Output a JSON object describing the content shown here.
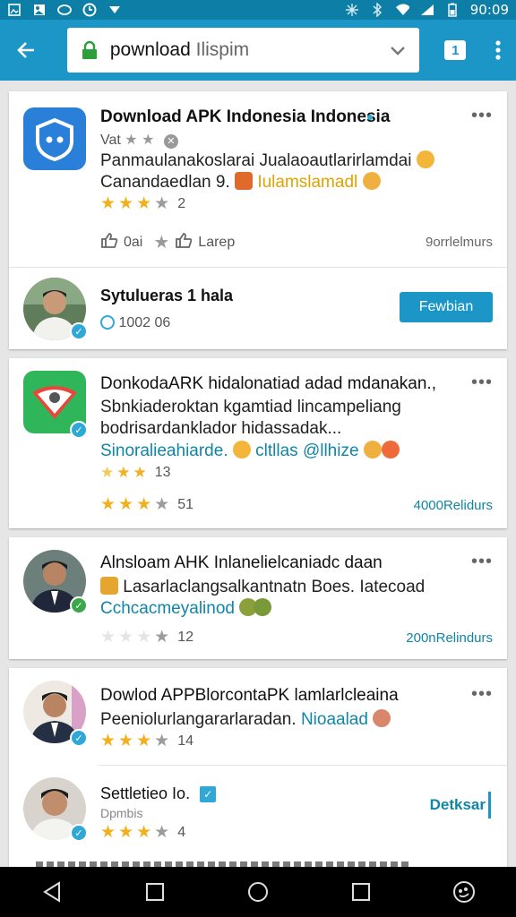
{
  "status_bar": {
    "time": "90:09"
  },
  "browser": {
    "url_primary": "pownload",
    "url_secondary": " Ilispim",
    "tab_count": "1"
  },
  "card1": {
    "title": "Download APK Indonesia Indonesia",
    "subtitle": "Vat",
    "line1": "Panmaulanakoslarai Jualaoautlarirlamdai",
    "line2_a": "Canandaedlan 9.",
    "line2_b": "Iulamslamadl",
    "rating_count": "2",
    "like_count": "0ai",
    "learn_label": "Larep",
    "meta": "9orrlelmurs",
    "author": {
      "name": "Sytulueras 1 hala",
      "stat": "1002 06",
      "button": "Fewbian"
    }
  },
  "card2": {
    "title": "DonkodaARK hidalonatiad adad mdanakan.,",
    "line1": "Sbnkiaderoktan kgamtiad lincampeliang",
    "line2": "bodrisardanklador hidassadak...",
    "line3_a": "Sinoralieahiarde.",
    "line3_b": "cltllas @llhize",
    "sub_rating_count": "13",
    "rating_count": "51",
    "meta": "4000Relidurs"
  },
  "card3": {
    "title": "Alnsloam AHK Inlanelielcaniadc daan",
    "line1": "Lasarlaclangsalkantnatn Boes. Iatecoad",
    "line2": "Cchcacmeyalinod",
    "rating_count": "12",
    "meta": "200nRelindurs"
  },
  "card4": {
    "title": "Dowlod APPBlorcontaPK lamlarlcleaina",
    "line1_a": "Peeniolurlangararlaradan.",
    "line1_b": "Nioaalad",
    "rating_count": "14",
    "second": {
      "name": "Settletieo Io.",
      "sub": "Dpmbis",
      "rating_count": "4",
      "button": "Detksar"
    }
  },
  "colors": {
    "status_bar": "#0d7ea5",
    "app_bar": "#1b96c6",
    "star": "#f2b01e",
    "accent": "#0f86a5"
  }
}
